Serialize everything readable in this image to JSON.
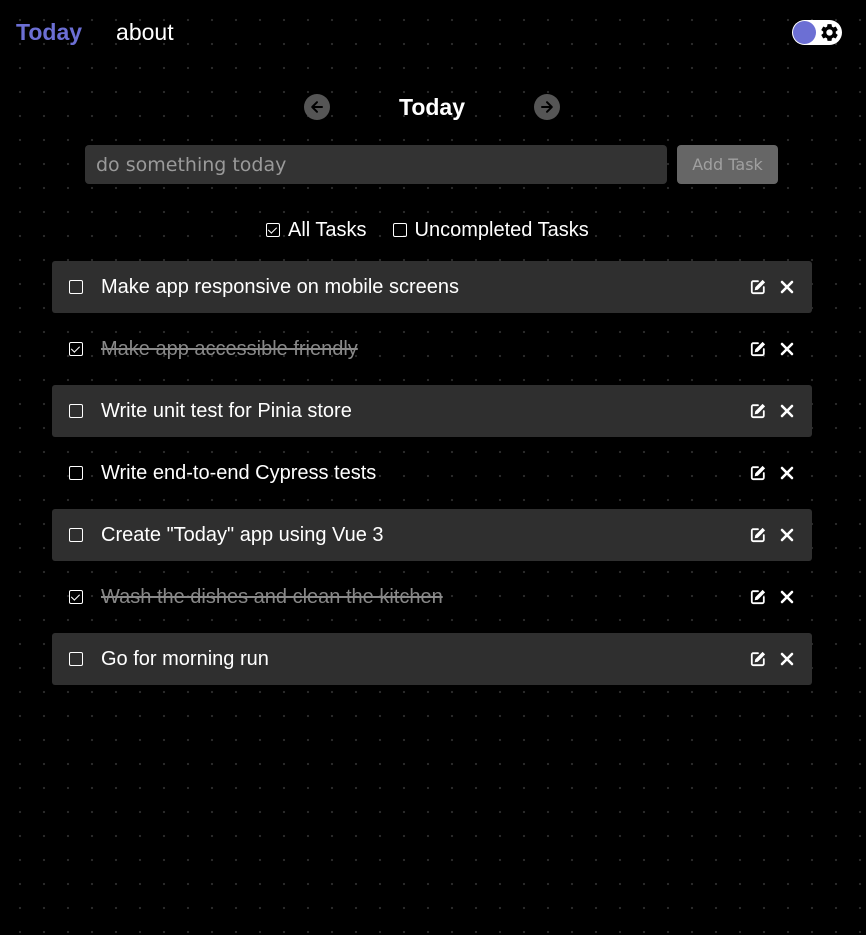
{
  "nav": {
    "brand": "Today",
    "about": "about"
  },
  "theme_toggle": {
    "icon": "gear-icon",
    "accent": "#6c6fd4"
  },
  "day_nav": {
    "title": "Today",
    "prev_icon": "arrow-left-icon",
    "next_icon": "arrow-right-icon"
  },
  "task_input": {
    "value": "",
    "placeholder": "do something today"
  },
  "add_button": {
    "label": "Add Task"
  },
  "filters": [
    {
      "label": "All Tasks",
      "checked": true
    },
    {
      "label": "Uncompleted Tasks",
      "checked": false
    }
  ],
  "tasks": [
    {
      "text": "Make app responsive on mobile screens",
      "done": false
    },
    {
      "text": "Make app accessible friendly",
      "done": true
    },
    {
      "text": "Write unit test for Pinia store",
      "done": false
    },
    {
      "text": "Write end-to-end Cypress tests",
      "done": false
    },
    {
      "text": "Create \"Today\" app using Vue 3",
      "done": false
    },
    {
      "text": "Wash the dishes and clean the kitchen",
      "done": true
    },
    {
      "text": "Go for morning run",
      "done": false
    }
  ]
}
